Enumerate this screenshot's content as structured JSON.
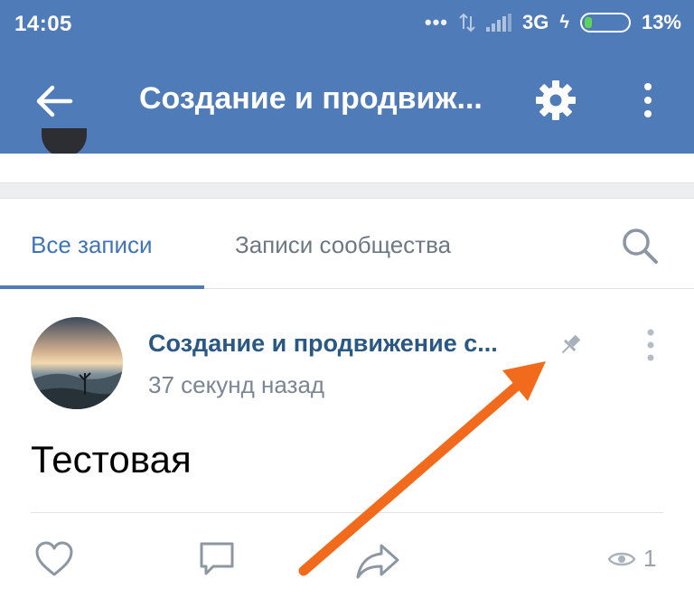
{
  "status_bar": {
    "time": "14:05",
    "dots": "•••",
    "network": "3G",
    "battery": "13%"
  },
  "app_bar": {
    "title": "Создание и продвиж..."
  },
  "tabs": [
    {
      "label": "Все записи",
      "active": true
    },
    {
      "label": "Записи сообщества",
      "active": false
    }
  ],
  "post": {
    "author": "Создание и продвижение с...",
    "time": "37 секунд назад",
    "text": "Тестовая",
    "views": "1"
  },
  "icons": [
    "back-arrow-icon",
    "gear-icon",
    "more-vertical-icon",
    "search-icon",
    "pin-icon",
    "heart-icon",
    "comment-icon",
    "share-icon",
    "eye-icon"
  ],
  "colors": {
    "app_bar": "#4f7bb8",
    "accent": "#3f74ba",
    "author": "#2a5885",
    "annotation_arrow": "#f26a1b"
  }
}
